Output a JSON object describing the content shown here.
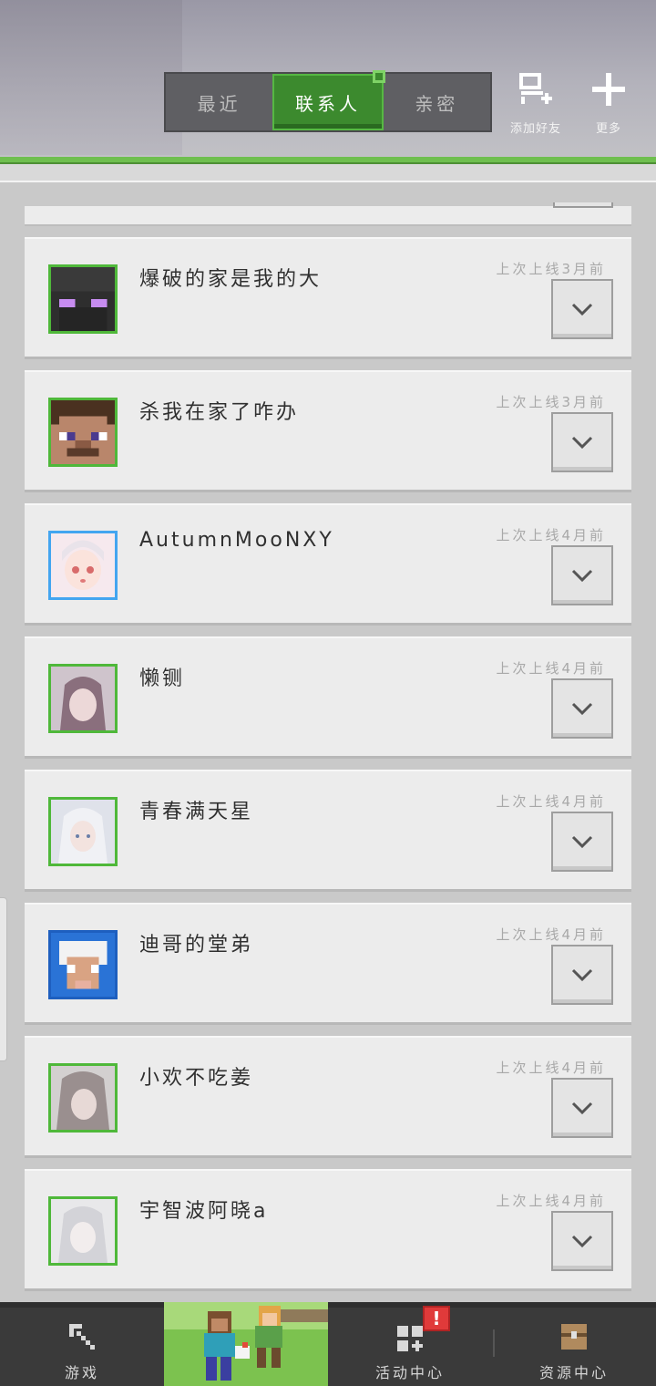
{
  "header": {
    "tabs": [
      {
        "label": "最近",
        "active": false
      },
      {
        "label": "联系人",
        "active": true
      },
      {
        "label": "亲密",
        "active": false
      }
    ],
    "add_friend_label": "添加好友",
    "more_label": "更多"
  },
  "contacts": [
    {
      "name": "爆破的家是我的大",
      "status": "上次上线3月前",
      "avatar": "enderman-icon"
    },
    {
      "name": "杀我在家了咋办",
      "status": "上次上线3月前",
      "avatar": "steve-icon"
    },
    {
      "name": "AutumnMooNXY",
      "status": "上次上线4月前",
      "avatar": "anime-girl-icon"
    },
    {
      "name": "懒铡",
      "status": "上次上线4月前",
      "avatar": "anime-portrait-icon"
    },
    {
      "name": "青春满天星",
      "status": "上次上线4月前",
      "avatar": "anime-portrait-icon"
    },
    {
      "name": "迪哥的堂弟",
      "status": "上次上线4月前",
      "avatar": "sheep-icon"
    },
    {
      "name": "小欢不吃姜",
      "status": "上次上线4月前",
      "avatar": "anime-portrait-icon"
    },
    {
      "name": "宇智波阿晓a",
      "status": "上次上线4月前",
      "avatar": "anime-portrait-icon"
    }
  ],
  "bottom_nav": [
    {
      "label": "游戏",
      "icon": "pickaxe-icon"
    },
    {
      "label": "",
      "icon": "banner-image"
    },
    {
      "label": "活动中心",
      "icon": "activity-icon"
    },
    {
      "label": "资源中心",
      "icon": "chest-icon"
    }
  ],
  "colors": {
    "accent_green": "#3c8a2e",
    "alert_red": "#e03a3a"
  }
}
